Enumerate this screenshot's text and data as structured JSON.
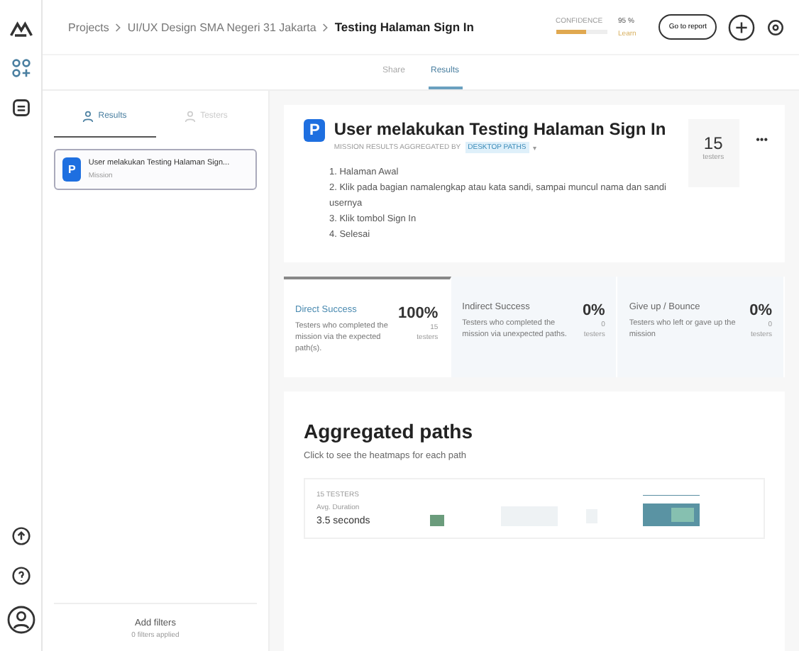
{
  "breadcrumb": [
    "Projects",
    "UI/UX Design SMA Negeri 31 Jakarta",
    "Testing Halaman Sign In"
  ],
  "confidence": {
    "label": "CONFIDENCE",
    "value": "95 %",
    "note": "Learn",
    "level": 0.6
  },
  "report_button": "Go to report",
  "view_tabs": [
    {
      "label": "Share",
      "selected": false
    },
    {
      "label": "Results",
      "selected": true
    }
  ],
  "panel_tabs": [
    {
      "label": "Results",
      "selected": true
    },
    {
      "label": "Testers",
      "selected": false
    }
  ],
  "missions": [
    {
      "badge": "P",
      "title": "User melakukan Testing Halaman Sign...",
      "subtitle": "Mission",
      "selected": true
    }
  ],
  "filters": {
    "label": "Add filters",
    "note": "0 filters applied"
  },
  "mission": {
    "badge": "P",
    "title": "User melakukan Testing Halaman Sign In",
    "aggregated_by": "MISSION RESULTS AGGREGATED BY",
    "aggregation": "DESKTOP PATHS",
    "caret": "▾",
    "steps": [
      "1. Halaman Awal",
      "2. Klik pada bagian namalengkap atau kata sandi, sampai muncul nama dan sandi usernya",
      "3. Klik tombol Sign In",
      "4. Selesai"
    ],
    "count": "15",
    "count_label": "testers",
    "menu": "•••"
  },
  "metrics": [
    {
      "title": "Direct Success",
      "description": "Testers who completed the mission via the expected path(s).",
      "value": "100%",
      "count": "15",
      "count_label": "testers",
      "selected": true
    },
    {
      "title": "Indirect Success",
      "description": "Testers who completed the mission via unexpected paths.",
      "value": "0%",
      "count": "0",
      "count_label": "testers",
      "selected": false
    },
    {
      "title": "Give up / Bounce",
      "description": "Testers who left or gave up the mission",
      "value": "0%",
      "count": "0",
      "count_label": "testers",
      "selected": false
    }
  ],
  "paths": {
    "title": "Aggregated paths",
    "subtitle": "Click to see the heatmaps for each path",
    "testers": "15 TESTERS",
    "duration_label": "Avg. Duration",
    "duration": "3.5 seconds"
  }
}
